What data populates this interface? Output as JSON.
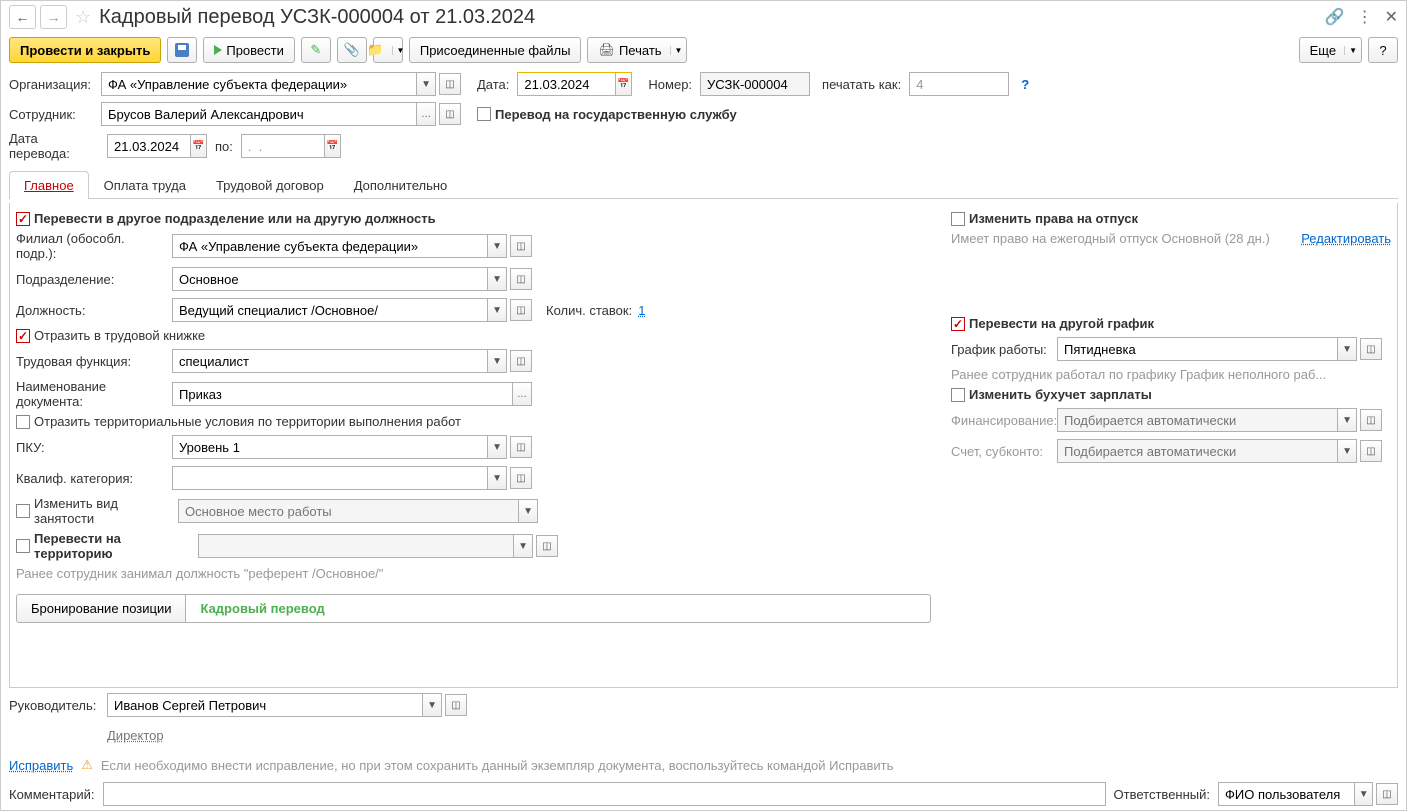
{
  "title": "Кадровый перевод УСЗК-000004 от 21.03.2024",
  "toolbar": {
    "conduct_close": "Провести и закрыть",
    "conduct": "Провести",
    "attachments": "Присоединенные файлы",
    "print": "Печать",
    "more": "Еще",
    "help": "?"
  },
  "header": {
    "org_label": "Организация:",
    "org_value": "ФА «Управление субъекта федерации»",
    "date_label": "Дата:",
    "date_value": "21.03.2024",
    "number_label": "Номер:",
    "number_value": "УСЗК-000004",
    "print_as_label": "печатать как:",
    "print_as_value": "4",
    "employee_label": "Сотрудник:",
    "employee_value": "Брусов Валерий Александрович",
    "gov_service": "Перевод на государственную службу",
    "transfer_date_label": "Дата перевода:",
    "transfer_date_value": "21.03.2024",
    "to_label": "по:",
    "to_value": ".  ."
  },
  "tabs": {
    "main": "Главное",
    "payment": "Оплата труда",
    "contract": "Трудовой договор",
    "extra": "Дополнительно"
  },
  "main": {
    "transfer_dept_cb": "Перевести в другое подразделение или на другую должность",
    "branch_label": "Филиал (обособл. подр.):",
    "branch_value": "ФА «Управление субъекта федерации»",
    "dept_label": "Подразделение:",
    "dept_value": "Основное",
    "position_label": "Должность:",
    "position_value": "Ведущий специалист /Основное/",
    "rates_label": "Колич. ставок:",
    "rates_value": "1",
    "reflect_cb": "Отразить в трудовой книжке",
    "function_label": "Трудовая функция:",
    "function_value": "специалист",
    "docname_label": "Наименование документа:",
    "docname_value": "Приказ",
    "territory_cb": "Отразить территориальные условия по территории выполнения работ",
    "pku_label": "ПКУ:",
    "pku_value": "Уровень 1",
    "qual_label": "Квалиф. категория:",
    "employment_cb": "Изменить вид занятости",
    "employment_ph": "Основное место работы",
    "transfer_terr_cb": "Перевести на территорию",
    "prev_note": "Ранее сотрудник занимал должность \"референт /Основное/\"",
    "btn_booking": "Бронирование позиции",
    "btn_transfer": "Кадровый перевод",
    "vacation_cb": "Изменить права на отпуск",
    "vacation_note": "Имеет право на ежегодный отпуск Основной (28 дн.)",
    "edit_link": "Редактировать",
    "schedule_cb": "Перевести на другой график",
    "schedule_label": "График работы:",
    "schedule_value": "Пятидневка",
    "schedule_note": "Ранее сотрудник работал по графику График неполного раб...",
    "accounting_cb": "Изменить бухучет зарплаты",
    "financing_label": "Финансирование:",
    "financing_ph": "Подбирается автоматически",
    "account_label": "Счет, субконто:",
    "account_ph": "Подбирается автоматически"
  },
  "footer": {
    "manager_label": "Руководитель:",
    "manager_value": "Иванов Сергей Петрович",
    "manager_position": "Директор",
    "fix_link": "Исправить",
    "fix_note": "Если необходимо внести исправление, но при этом сохранить данный экземпляр документа, воспользуйтесь командой Исправить",
    "comment_label": "Комментарий:",
    "responsible_label": "Ответственный:",
    "responsible_value": "ФИО пользователя"
  }
}
